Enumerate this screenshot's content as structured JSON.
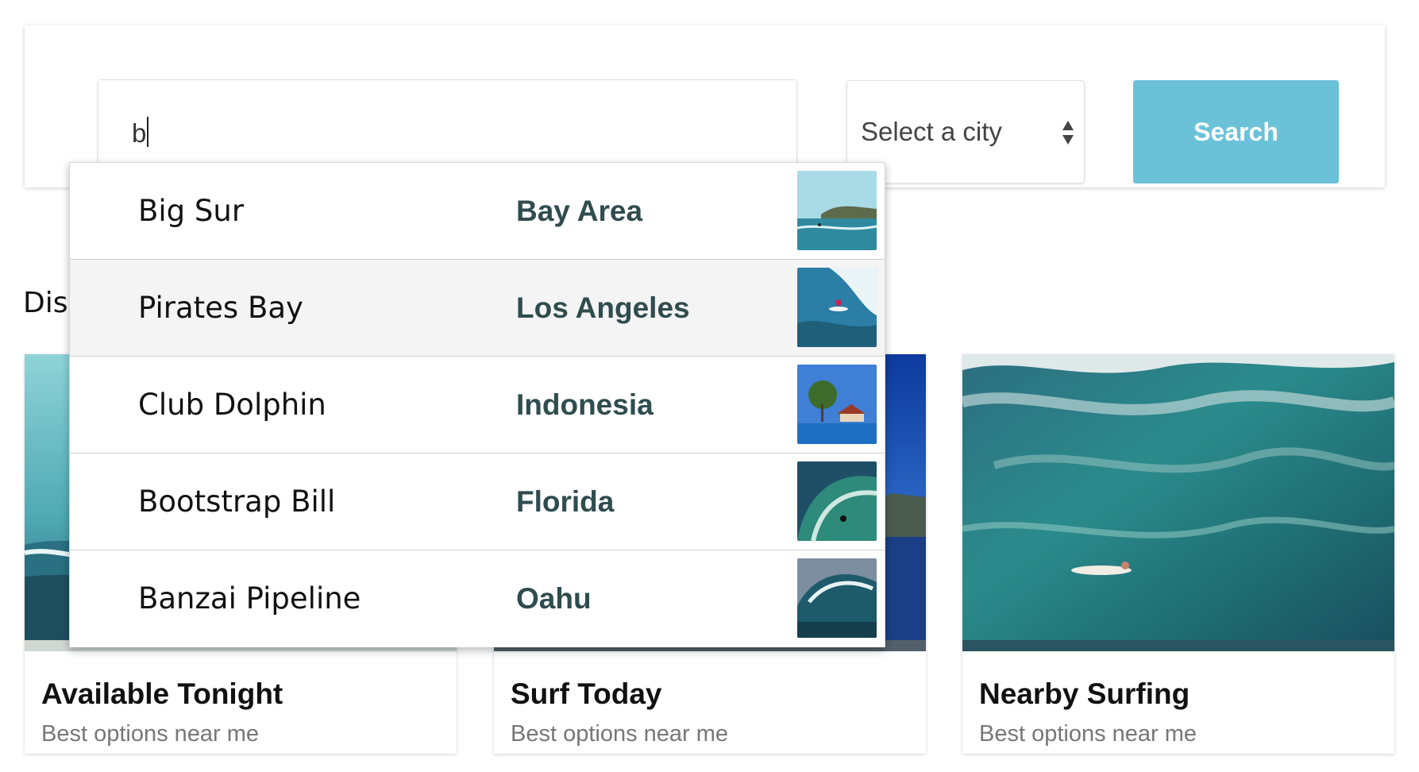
{
  "search": {
    "query": "b",
    "city_select_label": "Select a city",
    "button_label": "Search"
  },
  "section": {
    "heading_visible": "Dis"
  },
  "suggestions": [
    {
      "spot": "Big Sur",
      "region": "Bay Area",
      "thumb": "surfer-coast-photo"
    },
    {
      "spot": "Pirates Bay",
      "region": "Los Angeles",
      "thumb": "surfer-wave-photo"
    },
    {
      "spot": "Club Dolphin",
      "region": "Indonesia",
      "thumb": "resort-pool-photo"
    },
    {
      "spot": "Bootstrap Bill",
      "region": "Florida",
      "thumb": "barrel-wave-photo"
    },
    {
      "spot": "Banzai Pipeline",
      "region": "Oahu",
      "thumb": "pipeline-wave-photo"
    }
  ],
  "cards": [
    {
      "title": "Available Tonight",
      "subtitle": "Best options near me"
    },
    {
      "title": "Surf Today",
      "subtitle": "Best options near me"
    },
    {
      "title": "Nearby Surfing",
      "subtitle": "Best options near me"
    }
  ],
  "colors": {
    "search_button": "#6bc2d8",
    "region_text": "#2f4c4e",
    "active_row": "#f4f4f4",
    "subtitle_text": "#777777"
  }
}
